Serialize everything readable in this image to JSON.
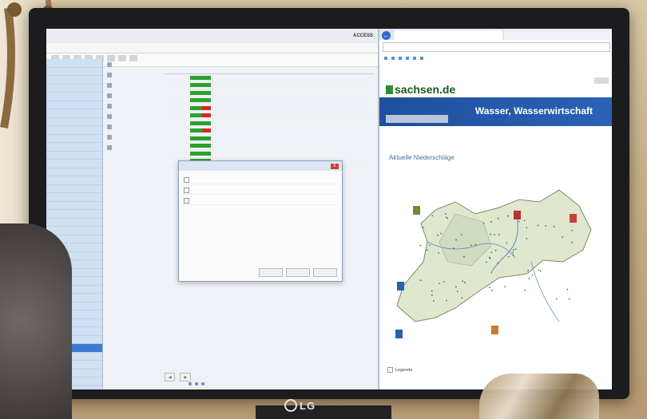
{
  "scene": {
    "monitor_brand": "LG"
  },
  "app": {
    "title": "",
    "brand": "ACCESS",
    "toolbar_buttons": 8,
    "tree_items": [
      "",
      "",
      "",
      "",
      "",
      "",
      "",
      "",
      "",
      "",
      "",
      "",
      "",
      "",
      "",
      "",
      "",
      "",
      "",
      "",
      "",
      "",
      "",
      "",
      "",
      "",
      "",
      "",
      "",
      "",
      "",
      "",
      "",
      "",
      "",
      "",
      "",
      "",
      "",
      ""
    ],
    "tree_selected_index": 34,
    "nav_items": [
      "",
      "",
      "",
      "",
      "",
      "",
      "",
      "",
      ""
    ],
    "table_rows": [
      {
        "fill": 1.0
      },
      {
        "fill": 1.0
      },
      {
        "fill": 1.0
      },
      {
        "fill": 1.0
      },
      {
        "fill": 0.55
      },
      {
        "fill": 0.55
      },
      {
        "fill": 1.0
      },
      {
        "fill": 0.6
      },
      {
        "fill": 1.0
      },
      {
        "fill": 1.0
      },
      {
        "fill": 1.0
      },
      {
        "fill": 1.0
      }
    ],
    "dialog": {
      "title": "",
      "close": "X",
      "buttons": [
        "",
        "",
        ""
      ]
    }
  },
  "browser": {
    "back_icon": "back-arrow-icon",
    "tabs": [
      "",
      ""
    ],
    "url": "",
    "site_logo": "sachsen.de",
    "banner_title": "Wasser, Wasserwirtschaft",
    "section_title": "Aktuelle Niederschläge",
    "legend_label": "Legende",
    "accent_color": "#1e4f9b",
    "logo_color": "#1a5a1e"
  }
}
